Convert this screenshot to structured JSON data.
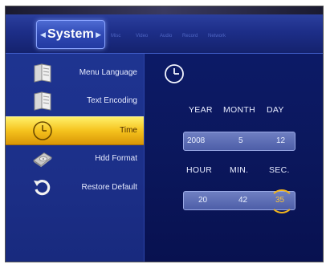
{
  "topbar": {
    "active_tab": "System",
    "other_tabs": [
      "Misc",
      "Video",
      "Audio",
      "Record",
      "Network"
    ]
  },
  "sidebar": {
    "items": [
      {
        "label": "Menu Language",
        "icon": "book-icon",
        "selected": false
      },
      {
        "label": "Text Encoding",
        "icon": "book-icon",
        "selected": false
      },
      {
        "label": "Time",
        "icon": "clock-icon",
        "selected": true
      },
      {
        "label": "Hdd Format",
        "icon": "hard-disk-icon",
        "selected": false
      },
      {
        "label": "Restore Default",
        "icon": "restore-arrow-icon",
        "selected": false
      }
    ]
  },
  "time_panel": {
    "icon": "clock-icon",
    "date_headers": {
      "year": "YEAR",
      "month": "MONTH",
      "day": "DAY"
    },
    "date_values": {
      "year": "2008",
      "month": "5",
      "day": "12"
    },
    "time_headers": {
      "hour": "HOUR",
      "min": "MIN.",
      "sec": "SEC."
    },
    "time_values": {
      "hour": "20",
      "min": "42",
      "sec": "35"
    },
    "active_field": "sec"
  },
  "colors": {
    "background": "#0b175c",
    "highlight": "#f5c21d",
    "active_value": "#f6c23b"
  }
}
